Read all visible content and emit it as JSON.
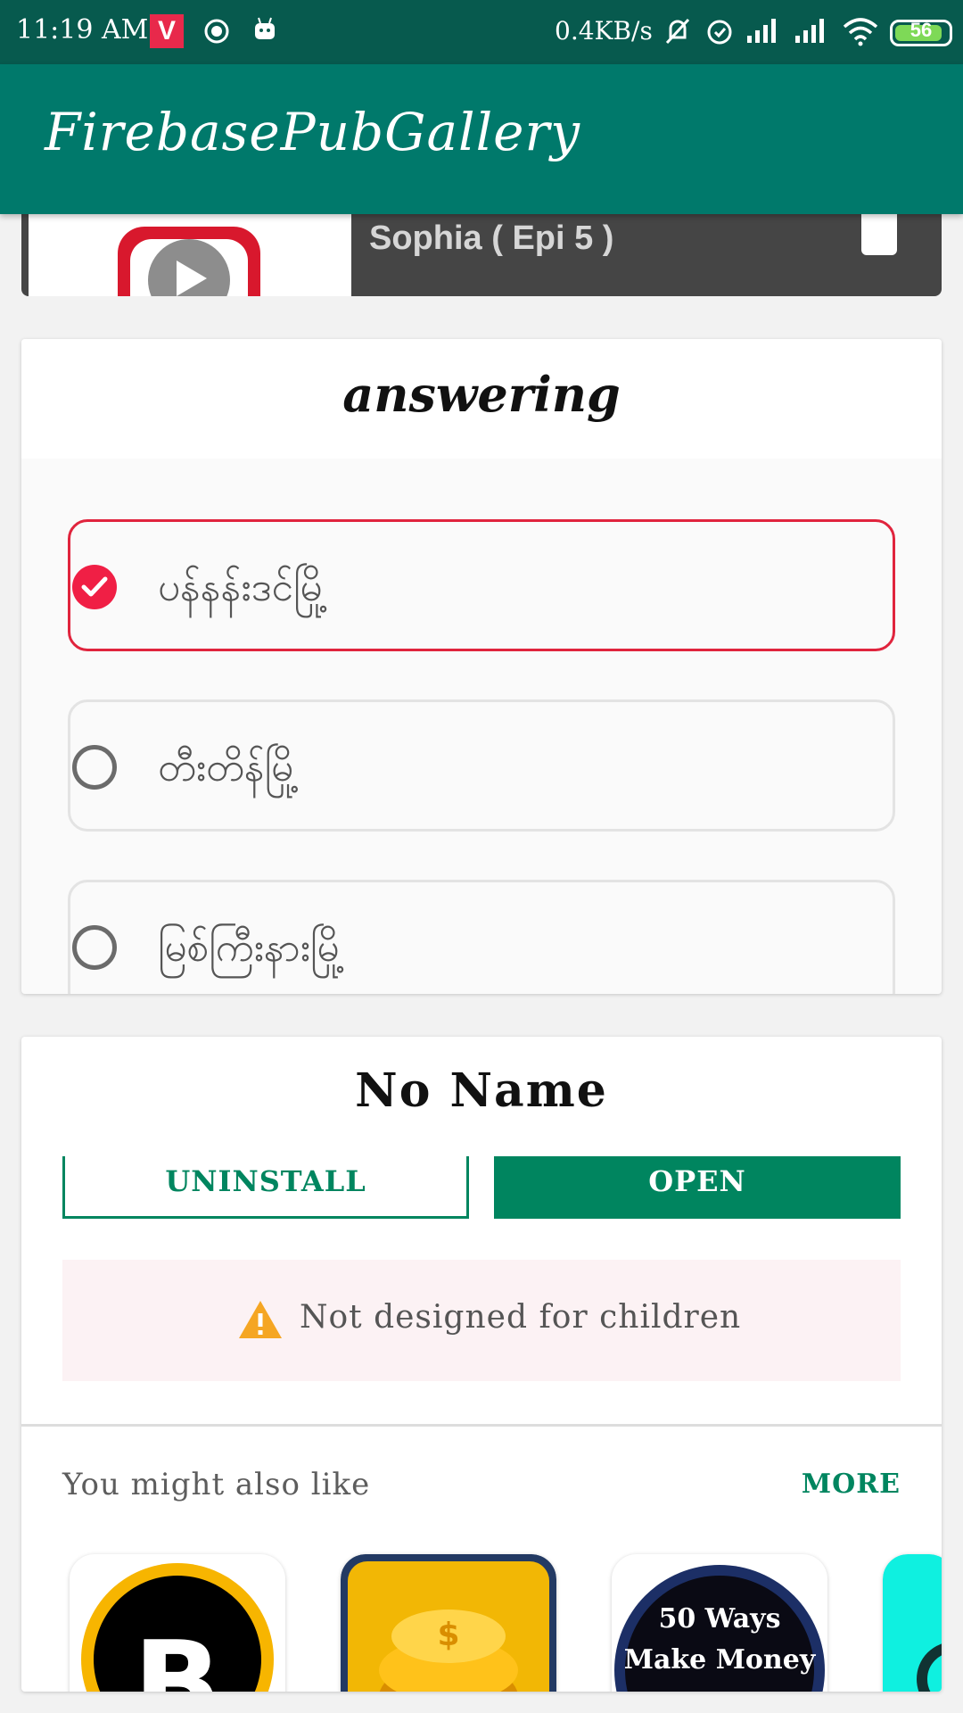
{
  "status_bar": {
    "time": "11:19 AM",
    "v_badge": "V",
    "speed": "0.4KB/s",
    "battery": "56",
    "battery_color": "#7ed957",
    "icons": [
      "record-icon",
      "android-icon",
      "mute-icon",
      "alarm-icon",
      "signal-icon",
      "signal-icon",
      "wifi-icon",
      "battery-icon"
    ]
  },
  "app_bar": {
    "title": "FirebasePubGallery",
    "color": "#00796b"
  },
  "video": {
    "title": "Sophia ( Epi 5 )"
  },
  "quiz": {
    "title": "answering",
    "options": [
      {
        "label": "ပန်နန်းဒင်မြို့",
        "selected": true
      },
      {
        "label": "တီးတိန်မြို့",
        "selected": false
      },
      {
        "label": "မြစ်ကြီးနားမြို့",
        "selected": false
      }
    ],
    "accent": "#e0243d"
  },
  "app_info": {
    "name": "No Name",
    "uninstall_label": "UNINSTALL",
    "open_label": "OPEN",
    "warning": "Not designed for children",
    "also_like": "You might also like",
    "more_label": "MORE",
    "brand": "#00855f",
    "recommended": [
      {
        "icon": "bitcoin-icon"
      },
      {
        "icon": "coins-icon"
      },
      {
        "icon": "make-money-icon",
        "text_line1": "50 Ways",
        "text_line2": "Make Money"
      },
      {
        "icon": "app-icon"
      }
    ]
  }
}
